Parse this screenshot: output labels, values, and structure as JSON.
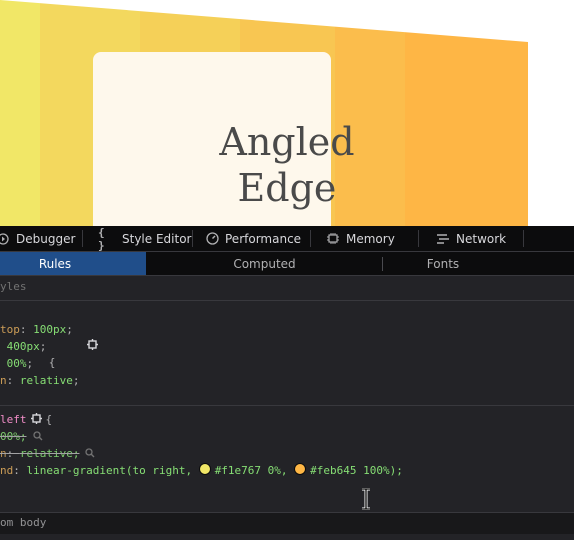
{
  "preview": {
    "card_title_line1": "Angled",
    "card_title_line2": "Edge",
    "stripe_colors": [
      "#f1e767",
      "#f3d85e",
      "#f5d058",
      "#f8c652",
      "#fbbd4c",
      "#feb645"
    ]
  },
  "toolbar": {
    "tabs": [
      {
        "label": "Debugger",
        "icon": "debugger-icon"
      },
      {
        "label": "Style Editor",
        "icon": "braces-icon"
      },
      {
        "label": "Performance",
        "icon": "gauge-icon"
      },
      {
        "label": "Memory",
        "icon": "memory-chip-icon"
      },
      {
        "label": "Network",
        "icon": "network-icon"
      }
    ]
  },
  "subtabs": {
    "rules": "Rules",
    "computed": "Computed",
    "fonts": "Fonts"
  },
  "filter": {
    "placeholder_fragment": "yles"
  },
  "rules": {
    "rule1": {
      "selector_fragment": "",
      "open_brace": "{",
      "decls": [
        {
          "name": "top",
          "value": "100px"
        },
        {
          "name": "",
          "value": "400px"
        },
        {
          "name": "",
          "value": "00%"
        },
        {
          "name": "n",
          "value": "relative"
        }
      ]
    },
    "rule2": {
      "selector_fragment": "left",
      "open_brace": "{",
      "decl1_value": "00%;",
      "decl2_name": "n",
      "decl2_value": "relative;",
      "decl3_name": "nd",
      "decl3_value_prefix": "linear-gradient(to right, ",
      "color1": "#f1e767",
      "color1_pos": " 0%, ",
      "color2": "#feb645",
      "color2_pos": " 100%);"
    }
  },
  "inherited": {
    "label": "om body"
  }
}
